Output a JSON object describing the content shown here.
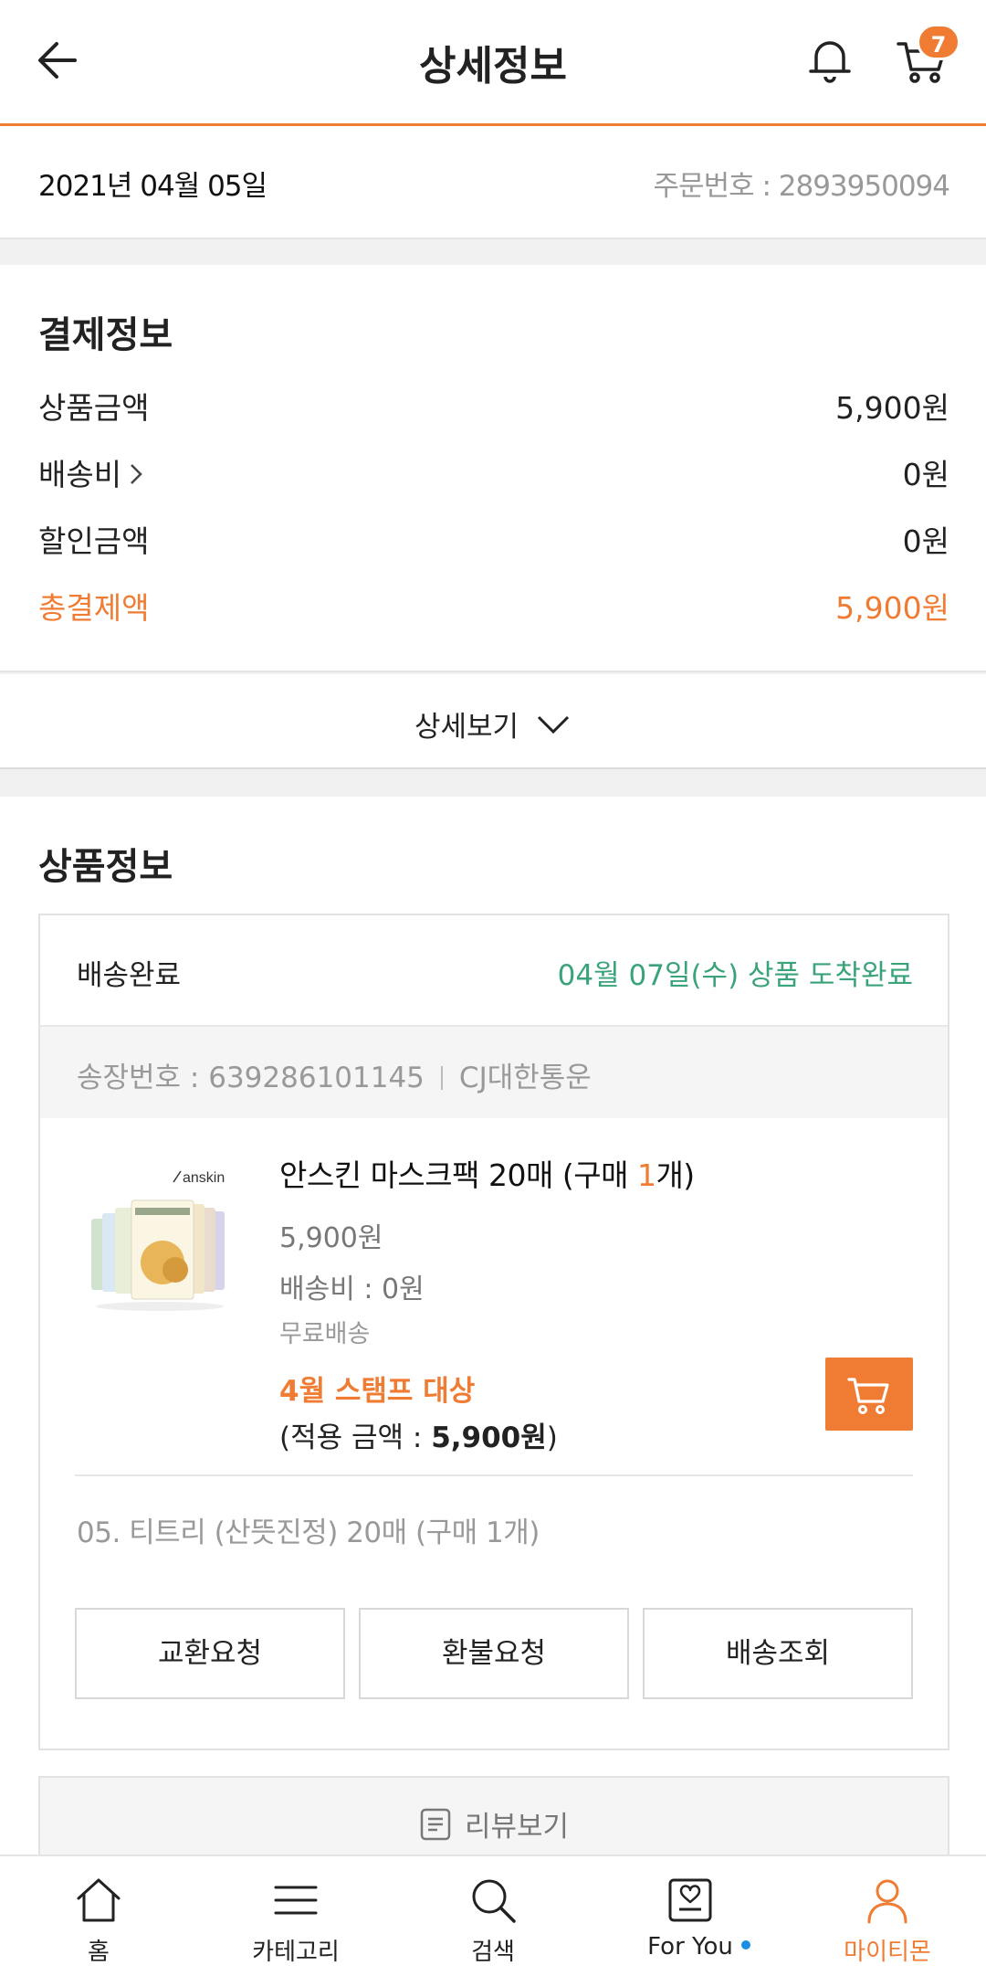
{
  "header": {
    "title": "상세정보",
    "cart_count": "7",
    "back_icon": "arrow-left-icon",
    "bell_icon": "bell-icon",
    "cart_icon": "cart-icon"
  },
  "order": {
    "date": "2021년 04월 05일",
    "order_number": "주문번호 : 2893950094"
  },
  "payment": {
    "title": "결제정보",
    "rows": [
      {
        "label": "상품금액",
        "value": "5,900원"
      },
      {
        "label": "배송비",
        "value": "0원"
      },
      {
        "label": "할인금액",
        "value": "0원"
      },
      {
        "label": "총결제액",
        "value": "5,900원"
      }
    ],
    "detail_toggle": "상세보기"
  },
  "product_section": {
    "title": "상품정보",
    "status": "배송완료",
    "arrival": "04월 07일(수) 상품 도착완료",
    "invoice_number": "송장번호 : 639286101145",
    "courier": "CJ대한통운",
    "item": {
      "name_prefix": "안스킨 마스크팩 20매 (구매 ",
      "qty": "1",
      "name_suffix": "개)",
      "price": "5,900원",
      "shipping": "배송비 : 0원",
      "free_shipping": "무료배송",
      "stamp": "4월 스탬프 대상",
      "apply_prefix": "(적용 금액 : ",
      "apply_amount": "5,900원",
      "apply_suffix": ")",
      "brand_logo_text": "anskin"
    },
    "sub_item": "05. 티트리 (산뜻진정) 20매 (구매 1개)",
    "actions": [
      "교환요청",
      "환불요청",
      "배송조회"
    ],
    "review_button": "리뷰보기"
  },
  "bottom_nav": [
    {
      "label": "홈",
      "icon": "home-icon"
    },
    {
      "label": "카테고리",
      "icon": "menu-icon"
    },
    {
      "label": "검색",
      "icon": "search-icon"
    },
    {
      "label": "For You",
      "icon": "for-you-icon"
    },
    {
      "label": "마이티몬",
      "icon": "user-icon",
      "active": true
    }
  ],
  "colors": {
    "accent": "#f07c33",
    "success": "#3aa37a",
    "notify_dot": "#1a8fe3"
  }
}
